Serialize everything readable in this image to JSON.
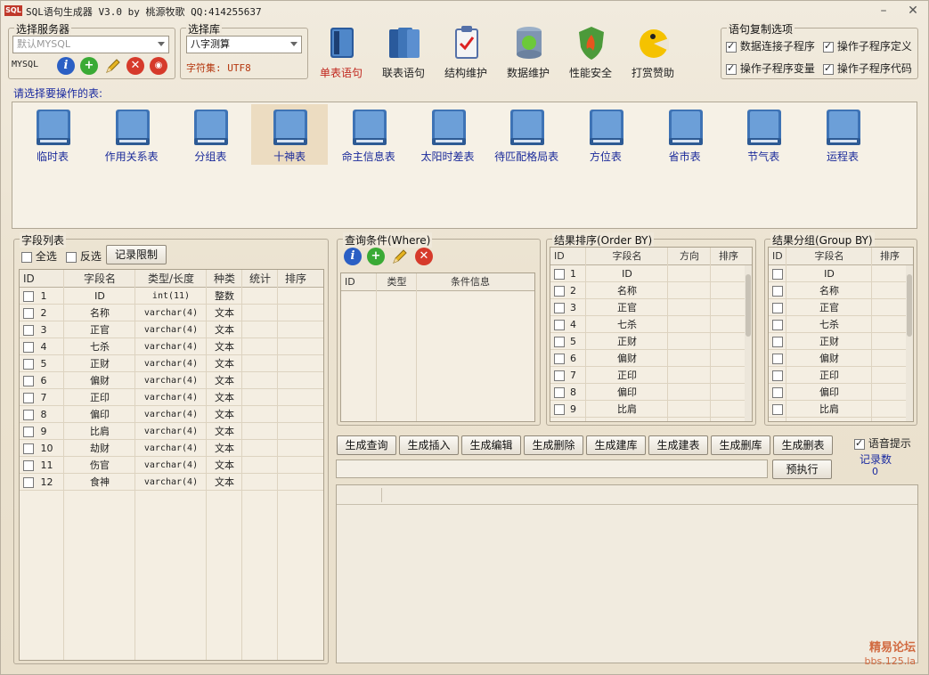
{
  "title": {
    "logo": "SQL",
    "text": "SQL语句生成器 V3.0 by 桃源牧歌  QQ:414255637"
  },
  "server": {
    "group": "选择服务器",
    "selected": "默认MYSQL",
    "type": "MYSQL"
  },
  "database": {
    "group": "选择库",
    "selected": "八字测算",
    "charset": "字符集: UTF8"
  },
  "toolbar": [
    {
      "label": "单表语句",
      "selected": true,
      "icon": "single-table-icon"
    },
    {
      "label": "联表语句",
      "selected": false,
      "icon": "join-table-icon"
    },
    {
      "label": "结构维护",
      "selected": false,
      "icon": "clipboard-icon"
    },
    {
      "label": "数据维护",
      "selected": false,
      "icon": "database-icon"
    },
    {
      "label": "性能安全",
      "selected": false,
      "icon": "shield-icon"
    },
    {
      "label": "打赏赞助",
      "selected": false,
      "icon": "pacman-icon"
    }
  ],
  "copy_options": {
    "group": "语句复制选项",
    "items": [
      {
        "label": "数据连接子程序",
        "checked": true
      },
      {
        "label": "操作子程序定义",
        "checked": true
      },
      {
        "label": "操作子程序变量",
        "checked": true
      },
      {
        "label": "操作子程序代码",
        "checked": true
      }
    ]
  },
  "tables": {
    "prompt": "请选择要操作的表:",
    "items": [
      "临时表",
      "作用关系表",
      "分组表",
      "十神表",
      "命主信息表",
      "太阳时差表",
      "待匹配格局表",
      "方位表",
      "省市表",
      "节气表",
      "运程表"
    ],
    "selected_index": 3
  },
  "fields": {
    "group": "字段列表",
    "select_all": "全选",
    "invert": "反选",
    "limit_button": "记录限制",
    "headers": [
      "ID",
      "字段名",
      "类型/长度",
      "种类",
      "统计",
      "排序"
    ],
    "rows": [
      [
        "1",
        "ID",
        "int(11)",
        "整数"
      ],
      [
        "2",
        "名称",
        "varchar(4)",
        "文本"
      ],
      [
        "3",
        "正官",
        "varchar(4)",
        "文本"
      ],
      [
        "4",
        "七杀",
        "varchar(4)",
        "文本"
      ],
      [
        "5",
        "正财",
        "varchar(4)",
        "文本"
      ],
      [
        "6",
        "偏财",
        "varchar(4)",
        "文本"
      ],
      [
        "7",
        "正印",
        "varchar(4)",
        "文本"
      ],
      [
        "8",
        "偏印",
        "varchar(4)",
        "文本"
      ],
      [
        "9",
        "比肩",
        "varchar(4)",
        "文本"
      ],
      [
        "10",
        "劫财",
        "varchar(4)",
        "文本"
      ],
      [
        "11",
        "伤官",
        "varchar(4)",
        "文本"
      ],
      [
        "12",
        "食神",
        "varchar(4)",
        "文本"
      ]
    ]
  },
  "where": {
    "group": "查询条件(Where)",
    "headers": [
      "ID",
      "类型",
      "条件信息"
    ]
  },
  "order": {
    "group": "结果排序(Order BY)",
    "headers": [
      "ID",
      "字段名",
      "方向",
      "排序"
    ],
    "rows": [
      [
        "1",
        "ID"
      ],
      [
        "2",
        "名称"
      ],
      [
        "3",
        "正官"
      ],
      [
        "4",
        "七杀"
      ],
      [
        "5",
        "正财"
      ],
      [
        "6",
        "偏财"
      ],
      [
        "7",
        "正印"
      ],
      [
        "8",
        "偏印"
      ],
      [
        "9",
        "比肩"
      ]
    ]
  },
  "group_by": {
    "group": "结果分组(Group BY)",
    "headers": [
      "ID",
      "字段名",
      "排序"
    ],
    "rows": [
      "ID",
      "名称",
      "正官",
      "七杀",
      "正财",
      "偏财",
      "正印",
      "偏印",
      "比肩"
    ]
  },
  "actions": [
    "生成查询",
    "生成插入",
    "生成编辑",
    "生成删除",
    "生成建库",
    "生成建表",
    "生成删库",
    "生成删表"
  ],
  "voice_hint": {
    "label": "语音提示",
    "checked": true
  },
  "records": {
    "label": "记录数",
    "value": "0"
  },
  "preexec_button": "预执行",
  "watermark": {
    "line1": "精易论坛",
    "line2": "bbs.125.la"
  }
}
